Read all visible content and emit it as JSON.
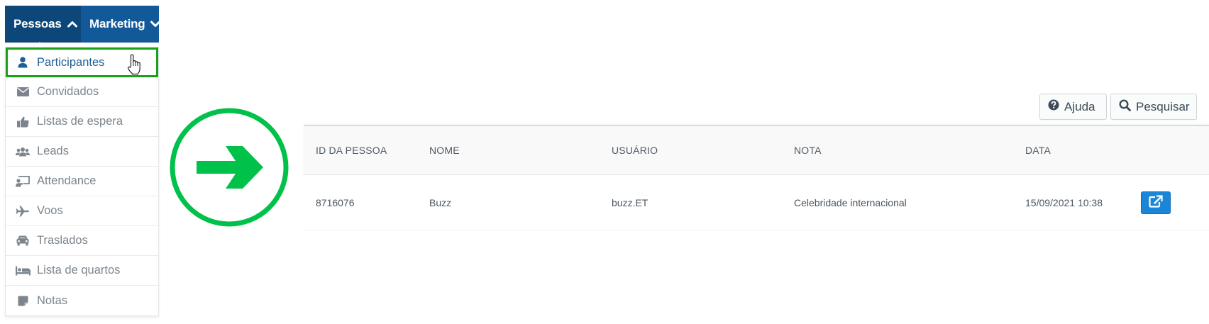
{
  "nav": {
    "tabs": [
      {
        "label": "Pessoas",
        "icon": "chevron-up-icon"
      },
      {
        "label": "Marketing",
        "icon": "chevron-down-icon"
      }
    ]
  },
  "menu": {
    "items": [
      {
        "label": "Participantes",
        "icon": "user-icon",
        "active": true
      },
      {
        "label": "Convidados",
        "icon": "envelope-icon"
      },
      {
        "label": "Listas de espera",
        "icon": "thumbs-up-icon"
      },
      {
        "label": "Leads",
        "icon": "users-icon"
      },
      {
        "label": "Attendance",
        "icon": "chalkboard-user-icon"
      },
      {
        "label": "Voos",
        "icon": "plane-icon"
      },
      {
        "label": "Traslados",
        "icon": "car-icon"
      },
      {
        "label": "Lista de quartos",
        "icon": "bed-icon"
      },
      {
        "label": "Notas",
        "icon": "sticky-note-icon"
      }
    ]
  },
  "toolbar": {
    "help_label": "Ajuda",
    "search_label": "Pesquisar"
  },
  "table": {
    "columns": [
      "ID DA PESSOA",
      "NOME",
      "USUÁRIO",
      "NOTA",
      "DATA"
    ],
    "rows": [
      {
        "id": "8716076",
        "name": "Buzz",
        "user": "buzz.ET",
        "note": "Celebridade internacional",
        "date": "15/09/2021 10:38"
      }
    ]
  },
  "colors": {
    "nav_primary": "#0d477a",
    "nav_secondary": "#12599a",
    "highlight_green": "#1aa11a",
    "arrow_green": "#00c24a",
    "action_blue": "#1a86d9"
  }
}
